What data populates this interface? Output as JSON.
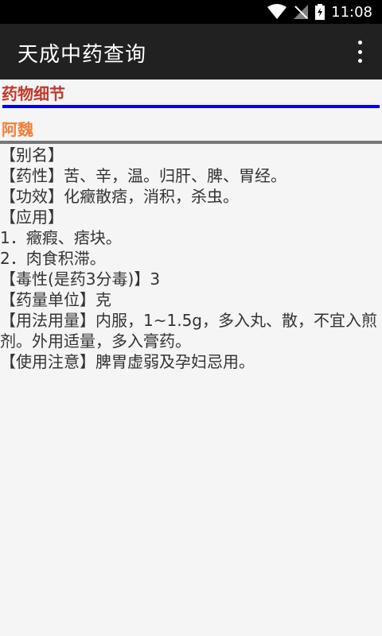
{
  "status_bar": {
    "time": "11:08",
    "icons": [
      "wifi-icon",
      "signal-off-icon",
      "battery-charging-icon"
    ]
  },
  "app_bar": {
    "title": "天成中药查询",
    "menu_icon": "more-vert-icon"
  },
  "section": {
    "title": "药物细节",
    "herb_name": "阿魏"
  },
  "details": [
    "【别名】",
    "【药性】苦、辛，温。归肝、脾、胃经。",
    "【功效】化癥散痞，消积，杀虫。",
    "【应用】",
    "1．癥瘕、痞块。",
    "2．肉食积滞。",
    "【毒性(是药3分毒)】3",
    "【药量单位】克",
    "【用法用量】内服，1~1.5g，多入丸、散，不宜入煎剂。外用适量，多入膏药。",
    "【使用注意】脾胃虚弱及孕妇忌用。"
  ],
  "colors": {
    "app_bar": "#212121",
    "section_title": "#c0392b",
    "herb_name": "#f0803a",
    "blue_rule": "#0000ee",
    "gray_rule": "#777777"
  }
}
